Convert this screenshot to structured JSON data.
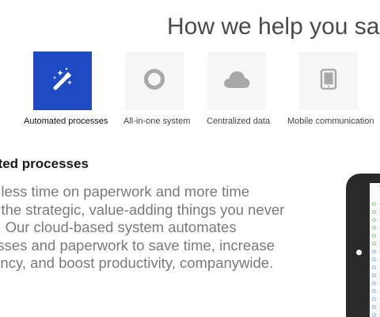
{
  "heading": "How we help you save",
  "features": [
    {
      "label": "Automated processes",
      "icon": "magic-wand-icon",
      "active": true
    },
    {
      "label": "All-in-one system",
      "icon": "circle-ring-icon",
      "active": false
    },
    {
      "label": "Centralized data",
      "icon": "cloud-icon",
      "active": false
    },
    {
      "label": "Mobile communication",
      "icon": "tablet-icon",
      "active": false
    }
  ],
  "section": {
    "title": "mated processes",
    "body_lines": [
      "d less time on paperwork and more time",
      "g the strategic, value-adding things you never",
      "p. Our cloud-based system automates",
      "esses and paperwork to save time, increase",
      "iency, and boost productivity, companywide."
    ]
  },
  "colors": {
    "accent": "#1e4bc4",
    "tile_bg": "#f6f6f6",
    "icon_gray": "#a8a8a8",
    "body_text": "#7a7a7a"
  }
}
